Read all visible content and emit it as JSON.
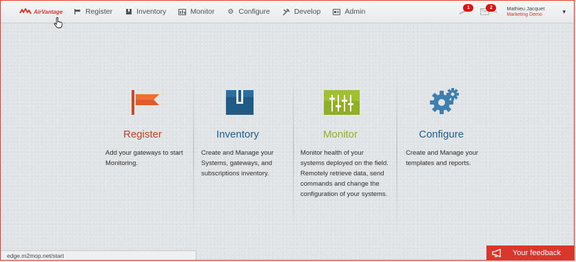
{
  "brand": {
    "name": "AirVantage"
  },
  "nav": {
    "items": [
      {
        "label": "Register",
        "icon": "register-icon"
      },
      {
        "label": "Inventory",
        "icon": "inventory-icon"
      },
      {
        "label": "Monitor",
        "icon": "monitor-icon"
      },
      {
        "label": "Configure",
        "icon": "gear-icon"
      },
      {
        "label": "Develop",
        "icon": "develop-icon"
      },
      {
        "label": "Admin",
        "icon": "admin-icon"
      }
    ]
  },
  "notifications": {
    "alerts_count": "1",
    "messages_count": "2"
  },
  "user": {
    "name": "Mathieu Jacquet",
    "company": "Marketing Demo"
  },
  "tiles": [
    {
      "title": "Register",
      "color": "#b3442b",
      "description": "Add your gateways to start Monitoring."
    },
    {
      "title": "Inventory",
      "color": "#1f5b86",
      "description": "Create and Manage your Systems, gateways, and subscriptions inventory."
    },
    {
      "title": "Monitor",
      "color": "#8fb026",
      "description": "Monitor health of your systems deployed on the field. Remotely retrieve data, send commands and change the configuration of your systems."
    },
    {
      "title": "Configure",
      "color": "#1f5b86",
      "description": "Create and Manage your templates and reports."
    }
  ],
  "statusbar": {
    "url": "edge.m2mop.net/start"
  },
  "feedback": {
    "label": "Your feedback"
  },
  "colors": {
    "accent": "#d9372b"
  }
}
